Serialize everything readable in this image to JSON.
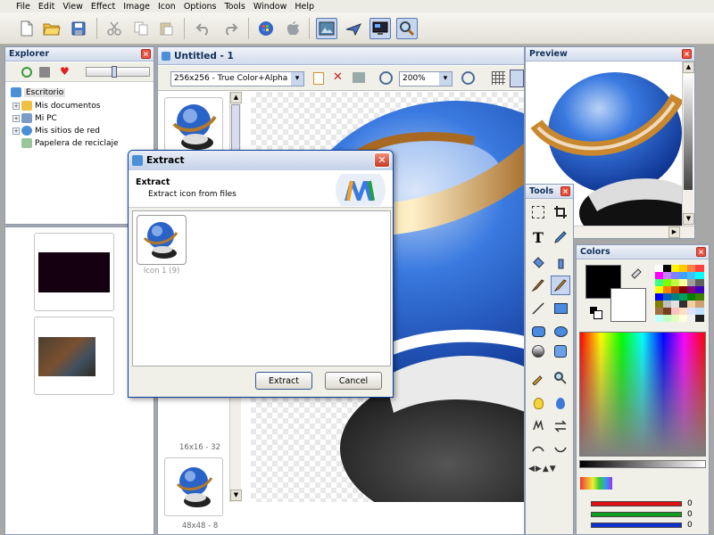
{
  "menu": [
    "File",
    "Edit",
    "View",
    "Effect",
    "Image",
    "Icon",
    "Options",
    "Tools",
    "Window",
    "Help"
  ],
  "explorer": {
    "title": "Explorer",
    "tree": [
      {
        "label": "Escritorio"
      },
      {
        "label": "Mis documentos"
      },
      {
        "label": "Mi PC"
      },
      {
        "label": "Mis sitios de red"
      },
      {
        "label": "Papelera de reciclaje"
      }
    ]
  },
  "document": {
    "title": "Untitled - 1",
    "format": "256x256 - True Color+Alpha",
    "zoom": "200%",
    "thumbs": [
      {
        "label": "16x16 - 32"
      },
      {
        "label": "48x48 - 8"
      }
    ]
  },
  "preview": {
    "title": "Preview"
  },
  "tools": {
    "title": "Tools"
  },
  "colors": {
    "title": "Colors",
    "rgb": [
      {
        "channel": "red",
        "value": "0",
        "color": "#e01010"
      },
      {
        "channel": "green",
        "value": "0",
        "color": "#10a020"
      },
      {
        "channel": "blue",
        "value": "0",
        "color": "#1030d0"
      }
    ],
    "palette": [
      "#ffffff",
      "#000000",
      "#fff200",
      "#ffc800",
      "#ff8040",
      "#ff4040",
      "#ff00ff",
      "#c080ff",
      "#8080ff",
      "#40a0ff",
      "#40c0ff",
      "#00ffff",
      "#40ff80",
      "#80ff00",
      "#c0ff40",
      "#ffffa0",
      "#a0a0a0",
      "#606060",
      "#ffff00",
      "#ff8000",
      "#c04000",
      "#800000",
      "#800080",
      "#4000c0",
      "#0000ff",
      "#0060c0",
      "#008080",
      "#00a060",
      "#008000",
      "#408000",
      "#808000",
      "#c0c0c0",
      "#e0e0e0",
      "#303030",
      "#f0d0a0",
      "#d0a070",
      "#a07040",
      "#704020",
      "#ffc0c0",
      "#ffe0c0",
      "#e0e0ff",
      "#c0e0ff",
      "#c0ffff",
      "#c0ffc0",
      "#e0ffc0",
      "#ffffe0",
      "#f0f0f0",
      "#202020"
    ]
  },
  "dialog": {
    "title": "Extract",
    "heading": "Extract",
    "subheading": "Extract icon from files",
    "item": "Icon 1 (9)",
    "extract": "Extract",
    "cancel": "Cancel"
  }
}
